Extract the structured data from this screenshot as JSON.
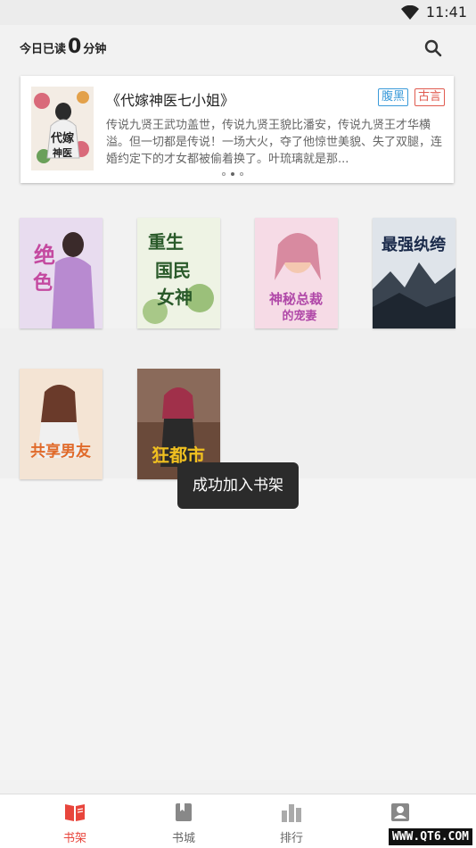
{
  "status": {
    "time": "11:41"
  },
  "header": {
    "reading_prefix": "今日已读",
    "reading_minutes": "0",
    "reading_suffix": "分钟"
  },
  "recommend": {
    "title": "《代嫁神医七小姐》",
    "tags": [
      "腹黑",
      "古言"
    ],
    "desc": "传说九贤王武功盖世，传说九贤王貌比潘安，传说九贤王才华横溢。但一切都是传说！一场大火，夺了他惊世美貌、失了双腿，连婚约定下的才女都被偷着换了。叶琉璃就是那...",
    "page_index": 2,
    "page_count": 3
  },
  "books": [
    {
      "cover_text": "绝色妃",
      "color": "#7a4aa0"
    },
    {
      "cover_text": "重生国民女神",
      "color": "#7aa04a"
    },
    {
      "cover_text": "神秘总裁的宠妻",
      "color": "#d87aa8"
    },
    {
      "cover_text": "最强纨绔",
      "color": "#2a3444"
    },
    {
      "cover_text": "共享男友",
      "color": "#e0a04a"
    },
    {
      "cover_text": "狂都市",
      "color": "#7a2a2a"
    }
  ],
  "toast": "成功加入书架",
  "tabs": [
    {
      "label": "书架",
      "icon": "bookshelf-icon"
    },
    {
      "label": "书城",
      "icon": "bookstore-icon"
    },
    {
      "label": "排行",
      "icon": "ranking-icon"
    },
    {
      "label": "",
      "icon": "profile-icon"
    }
  ],
  "colors": {
    "accent": "#e8453c",
    "tag_blue": "#3a9ad9",
    "tag_red": "#e05a4f"
  },
  "watermark": "WWW.QT6.COM"
}
